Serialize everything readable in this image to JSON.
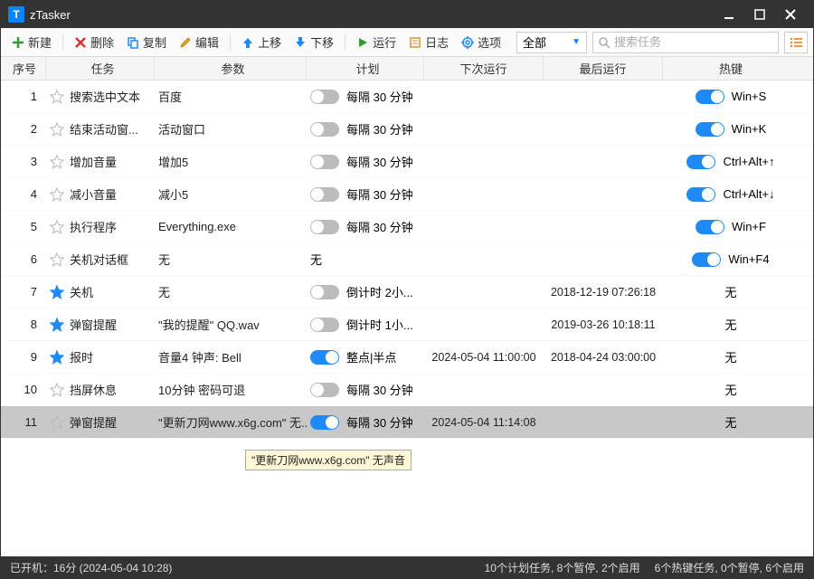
{
  "title": "zTasker",
  "toolbar": {
    "new_": "新建",
    "delete_": "删除",
    "copy": "复制",
    "edit": "编辑",
    "moveup": "上移",
    "movedown": "下移",
    "run": "运行",
    "log": "日志",
    "options": "选项"
  },
  "filter": {
    "selected": "全部"
  },
  "search": {
    "placeholder": "搜索任务"
  },
  "columns": [
    "序号",
    "任务",
    "参数",
    "计划",
    "下次运行",
    "最后运行",
    "热键"
  ],
  "rows": [
    {
      "idx": 1,
      "fav": false,
      "task": "搜索选中文本",
      "param": "百度",
      "plan_on": false,
      "plan": "每隔 30 分钟",
      "next": "",
      "last": "",
      "hk_on": true,
      "hk": "Win+S",
      "sel": false
    },
    {
      "idx": 2,
      "fav": false,
      "task": "结束活动窗...",
      "param": "活动窗口",
      "plan_on": false,
      "plan": "每隔 30 分钟",
      "next": "",
      "last": "",
      "hk_on": true,
      "hk": "Win+K",
      "sel": false
    },
    {
      "idx": 3,
      "fav": false,
      "task": "增加音量",
      "param": "增加5",
      "plan_on": false,
      "plan": "每隔 30 分钟",
      "next": "",
      "last": "",
      "hk_on": true,
      "hk": "Ctrl+Alt+↑",
      "sel": false
    },
    {
      "idx": 4,
      "fav": false,
      "task": "减小音量",
      "param": "减小5",
      "plan_on": false,
      "plan": "每隔 30 分钟",
      "next": "",
      "last": "",
      "hk_on": true,
      "hk": "Ctrl+Alt+↓",
      "sel": false
    },
    {
      "idx": 5,
      "fav": false,
      "task": "执行程序",
      "param": "Everything.exe",
      "plan_on": false,
      "plan": "每隔 30 分钟",
      "next": "",
      "last": "",
      "hk_on": true,
      "hk": "Win+F",
      "sel": false
    },
    {
      "idx": 6,
      "fav": false,
      "task": "关机对话框",
      "param": "无",
      "plan_on": null,
      "plan": "无",
      "next": "",
      "last": "",
      "hk_on": true,
      "hk": "Win+F4",
      "sel": false
    },
    {
      "idx": 7,
      "fav": true,
      "task": "关机",
      "param": "无",
      "plan_on": false,
      "plan": "倒计时 2小...",
      "next": "",
      "last": "2018-12-19 07:26:18",
      "hk_on": null,
      "hk": "无",
      "sel": false
    },
    {
      "idx": 8,
      "fav": true,
      "task": "弹窗提醒",
      "param": "\"我的提醒\" QQ.wav",
      "plan_on": false,
      "plan": "倒计时 1小...",
      "next": "",
      "last": "2019-03-26 10:18:11",
      "hk_on": null,
      "hk": "无",
      "sel": false
    },
    {
      "idx": 9,
      "fav": true,
      "task": "报时",
      "param": "音量4 钟声: Bell",
      "plan_on": true,
      "plan": "整点|半点",
      "next": "2024-05-04 11:00:00",
      "last": "2018-04-24 03:00:00",
      "hk_on": null,
      "hk": "无",
      "sel": false
    },
    {
      "idx": 10,
      "fav": false,
      "task": "挡屏休息",
      "param": "10分钟 密码可退",
      "plan_on": false,
      "plan": "每隔 30 分钟",
      "next": "",
      "last": "",
      "hk_on": null,
      "hk": "无",
      "sel": false
    },
    {
      "idx": 11,
      "fav": false,
      "task": "弹窗提醒",
      "param": "\"更新刀网www.x6g.com\" 无...",
      "plan_on": true,
      "plan": "每隔 30 分钟",
      "next": "2024-05-04 11:14:08",
      "last": "",
      "hk_on": null,
      "hk": "无",
      "sel": true
    }
  ],
  "tooltip": "\"更新刀网www.x6g.com\" 无声音",
  "status": {
    "left": "已开机：16分 (2024-05-04 10:28)",
    "plans": "10个计划任务, 8个暂停, 2个启用",
    "hotkeys": "6个热键任务, 0个暂停, 6个启用"
  },
  "colors": {
    "accent": "#1f8af5",
    "titlebar": "#333"
  }
}
